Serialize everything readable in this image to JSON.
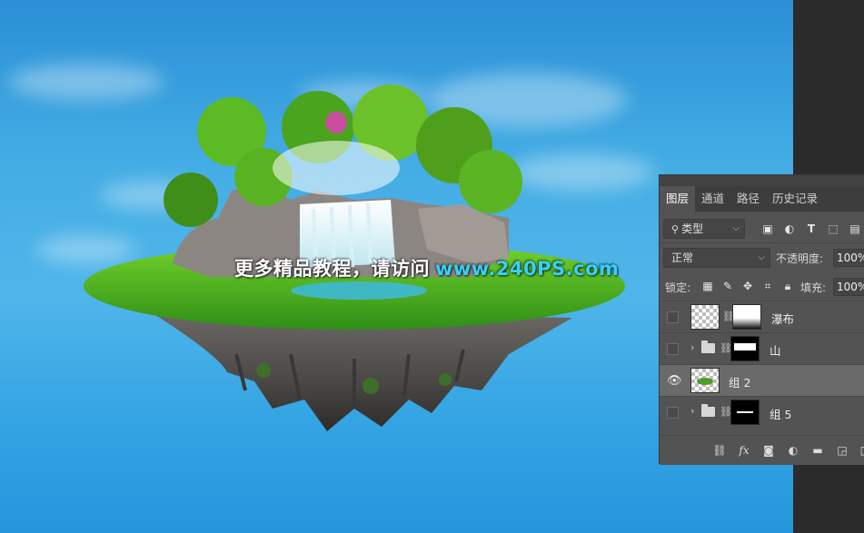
{
  "watermark": {
    "chinese_text": "更多精品教程，请访问",
    "url_text": "www.240PS.com"
  },
  "colors": {
    "sky_top": "#2a8fd6",
    "sky_mid": "#4fb6ea",
    "watermark_url": "#36d0f7",
    "panel_bg": "#535353",
    "panel_selected_row": "#6a6a6a"
  },
  "layers_panel": {
    "tabs": [
      {
        "label": "图层",
        "active": true
      },
      {
        "label": "通道",
        "active": false
      },
      {
        "label": "路径",
        "active": false
      },
      {
        "label": "历史记录",
        "active": false
      }
    ],
    "filter": {
      "kind_label": "类型",
      "icons": [
        "image-filter-icon",
        "adjustment-filter-icon",
        "type-filter-icon",
        "shape-filter-icon",
        "smart-object-filter-icon"
      ]
    },
    "blend_mode": "正常",
    "opacity_label": "不透明度:",
    "opacity_value": "100%",
    "lock_label": "锁定:",
    "lock_icons": [
      "lock-transparent-icon",
      "lock-pixels-icon",
      "lock-position-icon",
      "lock-artboard-icon",
      "lock-all-icon"
    ],
    "fill_label": "填充:",
    "fill_value": "100%",
    "layers": [
      {
        "name": "瀑布",
        "type": "smart-object",
        "visible": false,
        "selected": false
      },
      {
        "name": "山",
        "type": "group",
        "visible": false,
        "selected": false
      },
      {
        "name": "组 2",
        "type": "layer",
        "visible": true,
        "selected": true
      },
      {
        "name": "组 5",
        "type": "group",
        "visible": false,
        "selected": false
      }
    ],
    "footer_icons": [
      "link-layers-icon",
      "fx-icon",
      "add-mask-icon",
      "adjustment-layer-icon",
      "new-group-icon",
      "new-layer-icon",
      "delete-icon"
    ],
    "fx_label": "fx"
  }
}
